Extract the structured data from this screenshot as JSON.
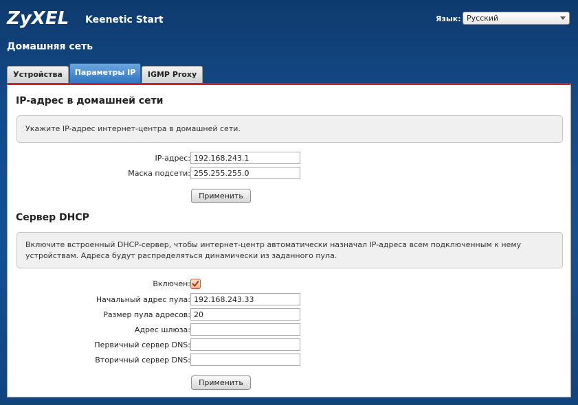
{
  "header": {
    "logo": "ZyXEL",
    "product": "Keenetic Start",
    "language_label": "Язык:",
    "language_value": "Русский"
  },
  "page_title": "Домашняя сеть",
  "tabs": [
    {
      "label": "Устройства",
      "active": false
    },
    {
      "label": "Параметры IP",
      "active": true
    },
    {
      "label": "IGMP Proxy",
      "active": false
    }
  ],
  "ip_section": {
    "title": "IP-адрес в домашней сети",
    "info": "Укажите IP-адрес интернет-центра в домашней сети.",
    "ip_label": "IP-адрес:",
    "ip_value": "192.168.243.1",
    "mask_label": "Маска подсети:",
    "mask_value": "255.255.255.0",
    "apply_label": "Применить"
  },
  "dhcp_section": {
    "title": "Сервер DHCP",
    "info_line1": "Включите встроенный DHCP-сервер, чтобы интернет-центр автоматически назначал IP-адреса всем подключенным к нему",
    "info_line2": "устройствам. Адреса будут распределяться динамически из заданного пула.",
    "enabled_label": "Включен:",
    "enabled": true,
    "pool_start_label": "Начальный адрес пула:",
    "pool_start_value": "192.168.243.33",
    "pool_size_label": "Размер пула адресов:",
    "pool_size_value": "20",
    "gateway_label": "Адрес шлюза:",
    "gateway_value": "",
    "dns1_label": "Первичный сервер DNS:",
    "dns1_value": "",
    "dns2_label": "Вторичный сервер DNS:",
    "dns2_value": "",
    "apply_label": "Применить"
  }
}
